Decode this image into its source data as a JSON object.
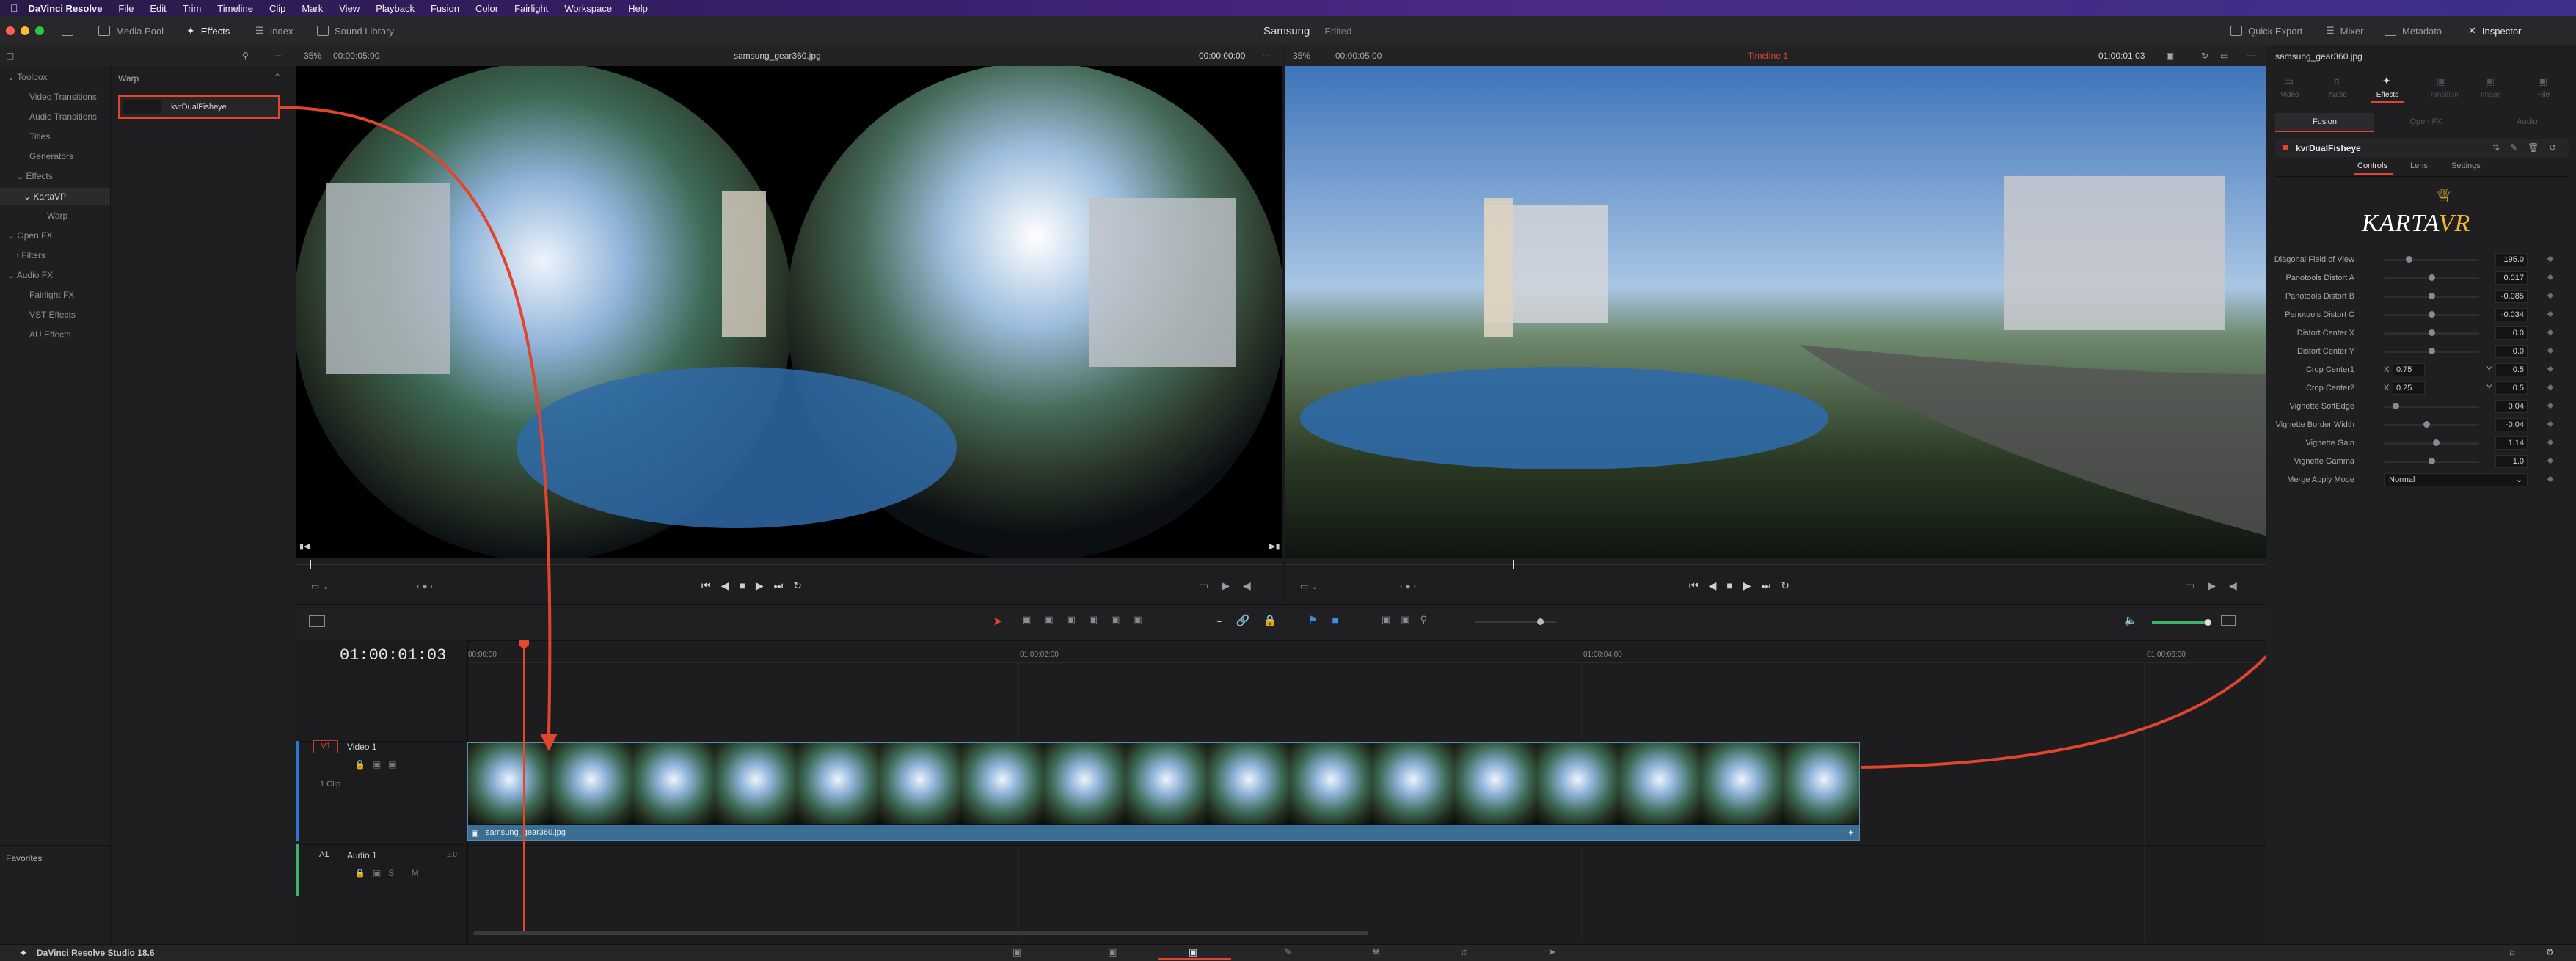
{
  "menubar": {
    "app_name": "DaVinci Resolve",
    "items": [
      "File",
      "Edit",
      "Trim",
      "Timeline",
      "Clip",
      "Mark",
      "View",
      "Playback",
      "Fusion",
      "Color",
      "Fairlight",
      "Workspace",
      "Help"
    ]
  },
  "toolbar": {
    "media_pool": "Media Pool",
    "effects": "Effects",
    "index": "Index",
    "sound_library": "Sound Library",
    "project_name": "Samsung",
    "project_status": "Edited",
    "quick_export": "Quick Export",
    "mixer": "Mixer",
    "metadata": "Metadata",
    "inspector": "Inspector"
  },
  "source_viewer": {
    "zoom": "35%",
    "duration": "00:00:05:00",
    "clip_name": "samsung_gear360.jpg",
    "timecode": "00:00:00:00"
  },
  "timeline_viewer": {
    "zoom": "35%",
    "duration": "00:00:05:00",
    "timeline_name": "Timeline 1",
    "timecode": "01:00:01:03"
  },
  "toolbox": {
    "items": [
      {
        "label": "Toolbox",
        "level": 0
      },
      {
        "label": "Video Transitions",
        "level": 1
      },
      {
        "label": "Audio Transitions",
        "level": 1
      },
      {
        "label": "Titles",
        "level": 1
      },
      {
        "label": "Generators",
        "level": 1
      },
      {
        "label": "Effects",
        "level": 1
      },
      {
        "label": "KartaVP",
        "level": 2
      },
      {
        "label": "Warp",
        "level": 3
      },
      {
        "label": "Open FX",
        "level": 0
      },
      {
        "label": "Filters",
        "level": 1
      },
      {
        "label": "Audio FX",
        "level": 0
      },
      {
        "label": "Fairlight FX",
        "level": 1
      },
      {
        "label": "VST Effects",
        "level": 1
      },
      {
        "label": "AU Effects",
        "level": 1
      }
    ],
    "favorites": "Favorites"
  },
  "warp_panel": {
    "title": "Warp",
    "effect_item": "kvrDualFisheye"
  },
  "timeline": {
    "timecode": "01:00:01:03",
    "ruler": [
      "00:00:00",
      "01:00:02:00",
      "01:00:04:00",
      "01:00:06:00"
    ],
    "video_track": {
      "badge": "V1",
      "name": "Video 1",
      "clips": "1 Clip"
    },
    "audio_track": {
      "badge": "A1",
      "name": "Audio 1",
      "level": "2.0"
    },
    "clip_name": "samsung_gear360.jpg",
    "playhead": 0.2
  },
  "inspector": {
    "clip_name": "samsung_gear360.jpg",
    "tabs": [
      "Video",
      "Audio",
      "Effects",
      "Transition",
      "Image",
      "File"
    ],
    "subtabs": [
      "Fusion",
      "Open FX",
      "Audio"
    ],
    "effect_name": "kvrDualFisheye",
    "control_tabs": [
      "Controls",
      "Lens",
      "Settings"
    ],
    "logo_text": "KARTA VR",
    "params": [
      {
        "label": "Diagonal Field of View",
        "value": "195.0",
        "knob": 0.25
      },
      {
        "label": "Panotools Distort A",
        "value": "0.017",
        "knob": 0.5
      },
      {
        "label": "Panotools Distort B",
        "value": "-0.085",
        "knob": 0.5
      },
      {
        "label": "Panotools Distort C",
        "value": "-0.034",
        "knob": 0.5
      },
      {
        "label": "Distort Center X",
        "value": "0.0",
        "knob": 0.5
      },
      {
        "label": "Distort Center Y",
        "value": "0.0",
        "knob": 0.5
      },
      {
        "label": "Vignette SoftEdge",
        "value": "0.04",
        "knob": 0.1
      },
      {
        "label": "Vignette Border Width",
        "value": "-0.04",
        "knob": 0.45
      },
      {
        "label": "Vignette Gain",
        "value": "1.14",
        "knob": 0.55
      },
      {
        "label": "Vignette Gamma",
        "value": "1.0",
        "knob": 0.5
      }
    ],
    "crop_center1": {
      "label": "Crop Center1",
      "x_label": "X",
      "x": "0.75",
      "y_label": "Y",
      "y": "0.5"
    },
    "crop_center2": {
      "label": "Crop Center2",
      "x_label": "X",
      "x": "0.25",
      "y_label": "Y",
      "y": "0.5"
    },
    "merge": {
      "label": "Merge Apply Mode",
      "value": "Normal"
    }
  },
  "status": {
    "app_version": "DaVinci Resolve Studio 18.6"
  },
  "colors": {
    "accent": "#e2442f",
    "clip": "#3b6e93",
    "playhead": "#e8452c"
  }
}
